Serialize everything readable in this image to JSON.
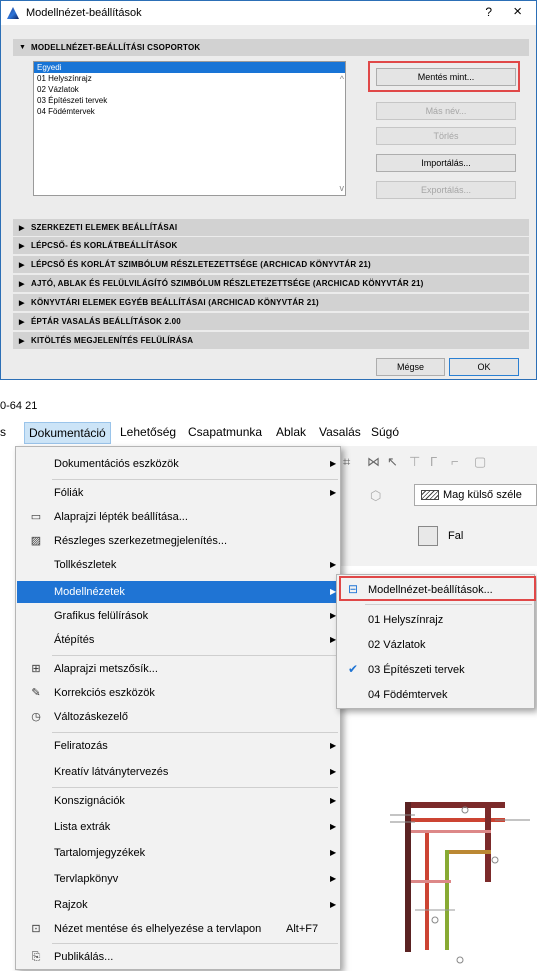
{
  "dialog": {
    "title": "Modellnézet-beállítások",
    "help": "?",
    "close": "×",
    "group_header": "MODELLNÉZET-BEÁLLÍTÁSI CSOPORTOK",
    "list_items": [
      "Egyedi",
      "01 Helyszínrajz",
      "02 Vázlatok",
      "03 Építészeti tervek",
      "04 Födémtervek"
    ],
    "selected_index": 0,
    "buttons": {
      "save_as": "Mentés mint...",
      "rename": "Más név...",
      "delete": "Törlés",
      "import": "Importálás...",
      "export": "Exportálás..."
    },
    "sections": [
      "SZERKEZETI ELEMEK BEÁLLÍTÁSAI",
      "LÉPCSŐ- ÉS KORLÁTBEÁLLÍTÁSOK",
      "LÉPCSŐ ÉS KORLÁT SZIMBÓLUM RÉSZLETEZETTSÉGE (ARCHICAD KÖNYVTÁR 21)",
      "AJTÓ, ABLAK ÉS FELÜLVILÁGÍTÓ SZIMBÓLUM RÉSZLETEZETTSÉGE (ARCHICAD KÖNYVTÁR 21)",
      "KÖNYVTÁRI ELEMEK EGYÉB BEÁLLÍTÁSAI (ARCHICAD KÖNYVTÁR 21)",
      "ÉPTÁR VASALÁS BEÁLLÍTÁSOK 2.00",
      "KITÖLTÉS MEGJELENÍTÉS FELÜLÍRÁSA"
    ],
    "cancel": "Mégse",
    "ok": "OK",
    "highlight_color": "#e04848"
  },
  "window_title_partial": "0-64 21",
  "menubar": [
    "s",
    "Dokumentáció",
    "Lehetőség",
    "Csapatmunka",
    "Ablak",
    "Vasalás",
    "Súgó"
  ],
  "toolbar": {
    "edge_label": "Mag külső széle",
    "wall_label": "Fal"
  },
  "doc_menu": [
    {
      "label": "Dokumentációs eszközök",
      "submenu": true
    },
    {
      "label": "Fóliák",
      "submenu": true
    },
    {
      "label": "Alaprajzi lépték beállítása...",
      "icon": "scale-icon"
    },
    {
      "label": "Részleges szerkezetmegjelenítés...",
      "icon": "hatch-icon"
    },
    {
      "label": "Tollkészletek",
      "submenu": true
    },
    {
      "label": "Modellnézetek",
      "submenu": true,
      "active": true
    },
    {
      "label": "Grafikus felülírások",
      "submenu": true
    },
    {
      "label": "Átépítés",
      "submenu": true
    },
    {
      "label": "Alaprajzi metszősík...",
      "icon": "cut-plane-icon"
    },
    {
      "label": "Korrekciós eszközök",
      "icon": "pencil-icon"
    },
    {
      "label": "Változáskezelő",
      "icon": "change-manager-icon"
    },
    {
      "label": "Feliratozás",
      "submenu": true
    },
    {
      "label": "Kreatív látványtervezés",
      "submenu": true
    },
    {
      "label": "Konszignációk",
      "submenu": true
    },
    {
      "label": "Lista extrák",
      "submenu": true
    },
    {
      "label": "Tartalomjegyzékek",
      "submenu": true
    },
    {
      "label": "Tervlapkönyv",
      "submenu": true
    },
    {
      "label": "Rajzok",
      "submenu": true
    },
    {
      "label": "Nézet mentése és elhelyezése a tervlapon",
      "icon": "save-view-icon",
      "shortcut": "Alt+F7"
    },
    {
      "label": "Publikálás...",
      "icon": "publish-icon"
    }
  ],
  "model_view_submenu": [
    {
      "label": "Modellnézet-beállítások...",
      "icon": "model-view-options-icon"
    },
    {
      "label": "01 Helyszínrajz"
    },
    {
      "label": "02 Vázlatok"
    },
    {
      "label": "03 Építészeti tervek",
      "checked": true
    },
    {
      "label": "04 Födémtervek"
    }
  ],
  "accent_color": "#1f74d4"
}
